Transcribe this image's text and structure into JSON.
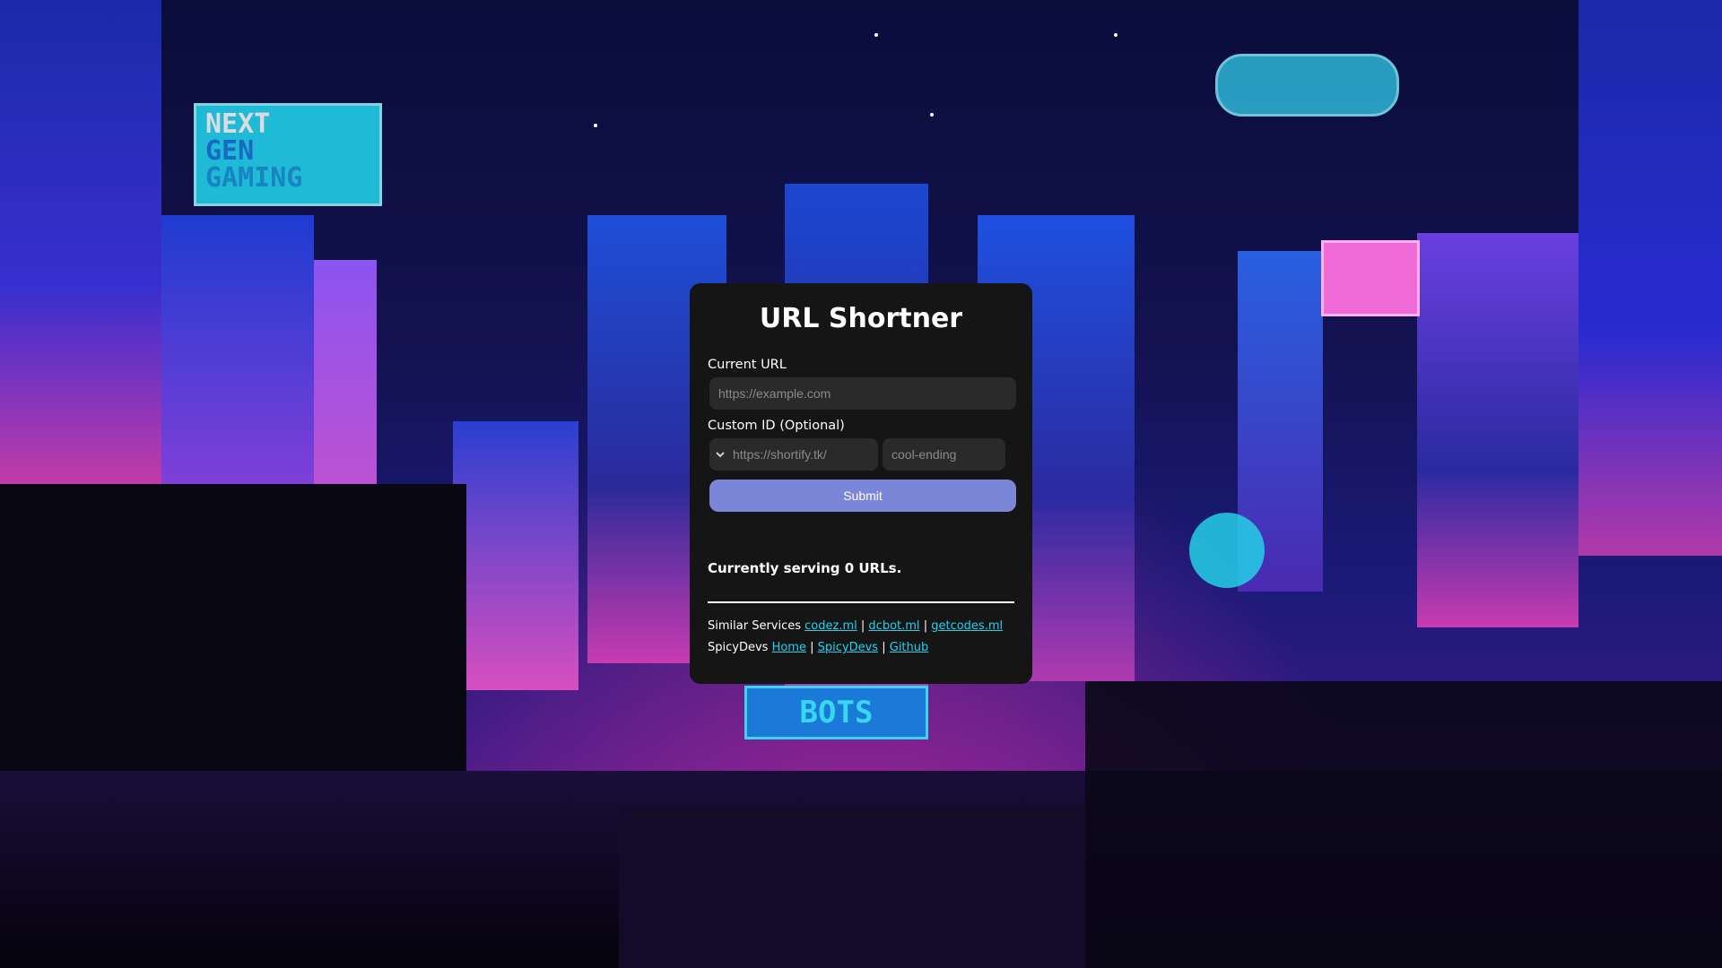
{
  "title": "URL Shortner",
  "form": {
    "current_url_label": "Current URL",
    "current_url_placeholder": "https://example.com",
    "custom_id_label": "Custom ID (Optional)",
    "domain_selected": "https://shortify.tk/",
    "custom_id_placeholder": "cool-ending",
    "submit_label": "Submit"
  },
  "status": {
    "serving_text": "Currently serving 0 URLs."
  },
  "footer": {
    "similar_label": "Similar Services",
    "similar_links": [
      "codez.ml",
      "dcbot.ml",
      "getcodes.ml"
    ],
    "spicy_label": "SpicyDevs",
    "spicy_links": [
      "Home",
      "SpicyDevs",
      "Github"
    ],
    "separator": "|"
  },
  "background": {
    "signs": [
      "NEXT",
      "GEN",
      "GAMING",
      "BOTS"
    ]
  },
  "colors": {
    "panel": "#151515",
    "input": "#2a2a2a",
    "submit": "#7b86d6",
    "link": "#22d3ee"
  }
}
